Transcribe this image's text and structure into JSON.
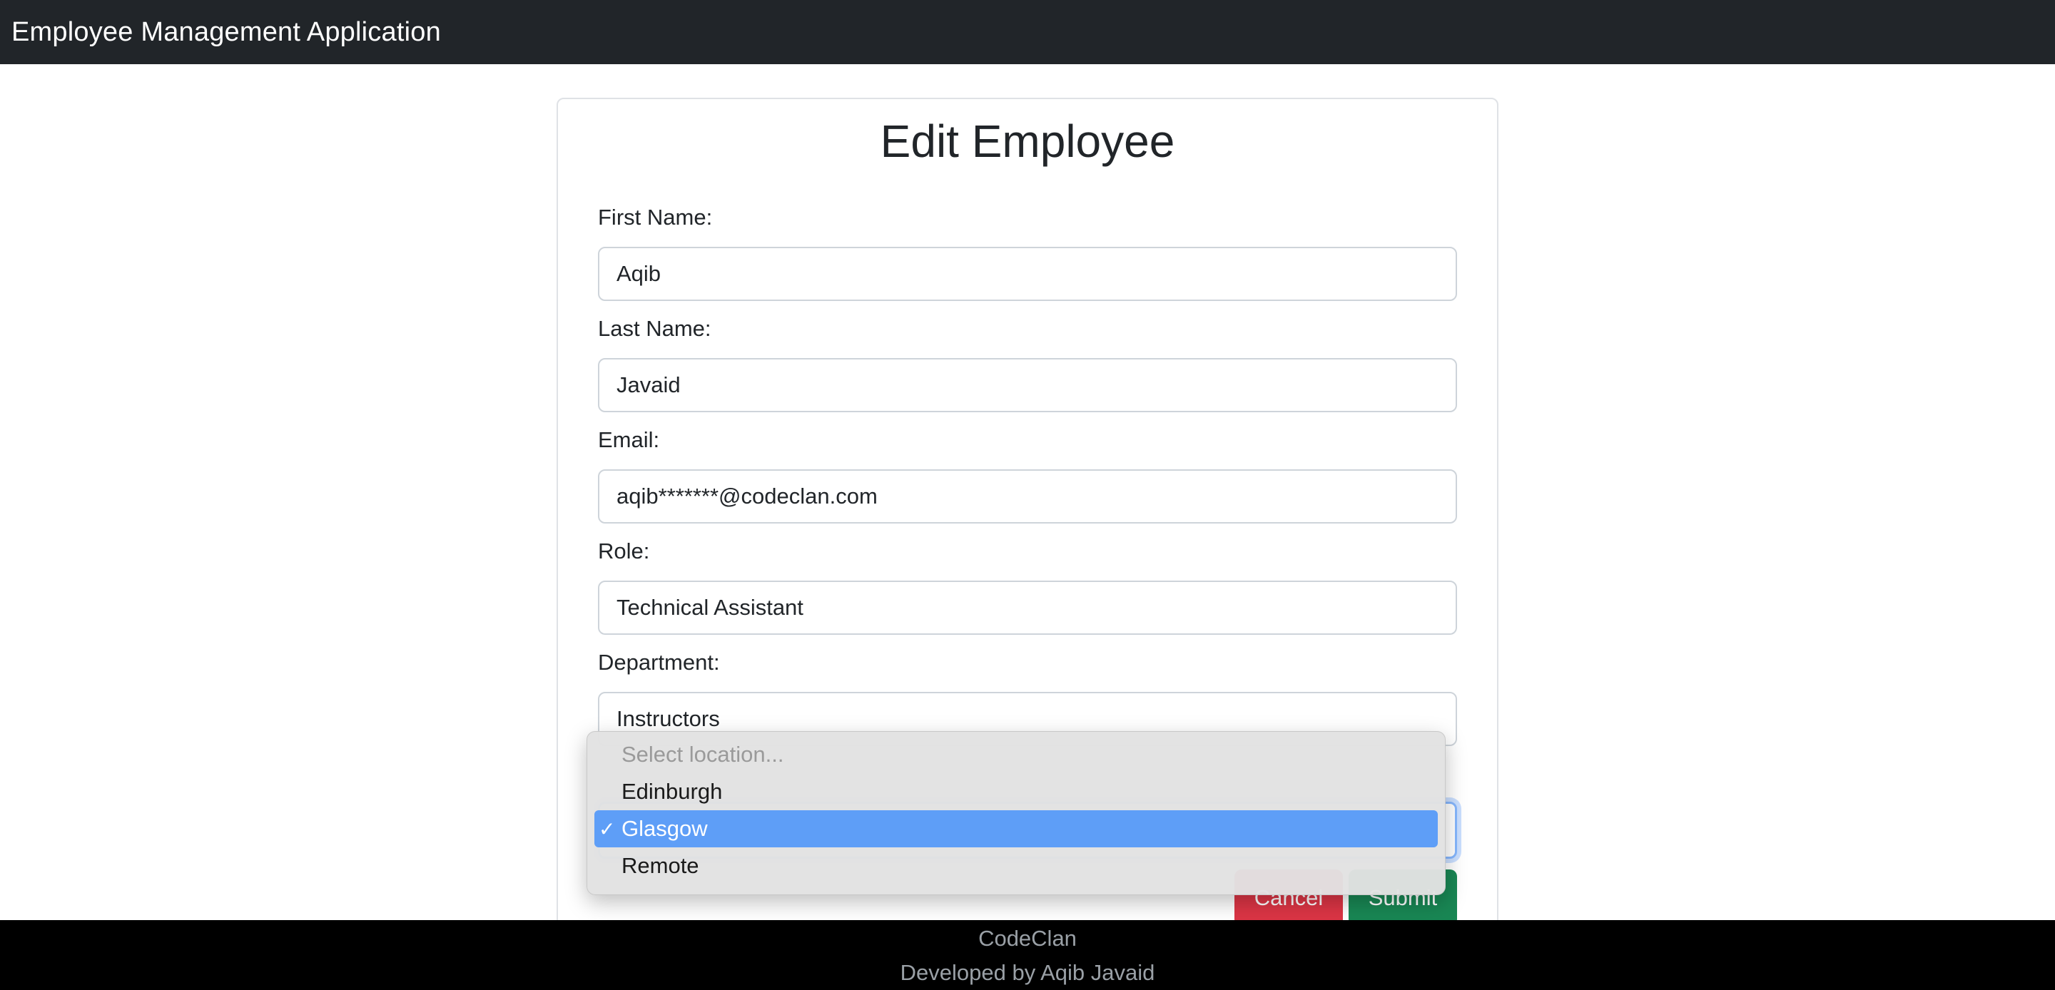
{
  "app": {
    "title": "Employee Management Application"
  },
  "form": {
    "heading": "Edit Employee",
    "fields": [
      {
        "label": "First Name:",
        "value": "Aqib"
      },
      {
        "label": "Last Name:",
        "value": "Javaid"
      },
      {
        "label": "Email:",
        "value": "aqib*******@codeclan.com"
      },
      {
        "label": "Role:",
        "value": "Technical Assistant"
      },
      {
        "label": "Department:",
        "value": "Instructors"
      }
    ],
    "location_select": {
      "selected": "Glasgow",
      "options": [
        {
          "label": "Select location...",
          "placeholder": true
        },
        {
          "label": "Edinburgh"
        },
        {
          "label": "Glasgow",
          "selected": true
        },
        {
          "label": "Remote"
        }
      ],
      "check_glyph": "✓"
    },
    "buttons": {
      "cancel": "Cancel",
      "submit": "Submit"
    }
  },
  "footer": {
    "line1": "CodeClan",
    "line2": "Developed by Aqib Javaid"
  },
  "colors": {
    "navbar": "#212529",
    "footer": "#000000",
    "cancel": "#dc3545",
    "submit": "#198754",
    "selected_option": "#5e9ef7"
  }
}
